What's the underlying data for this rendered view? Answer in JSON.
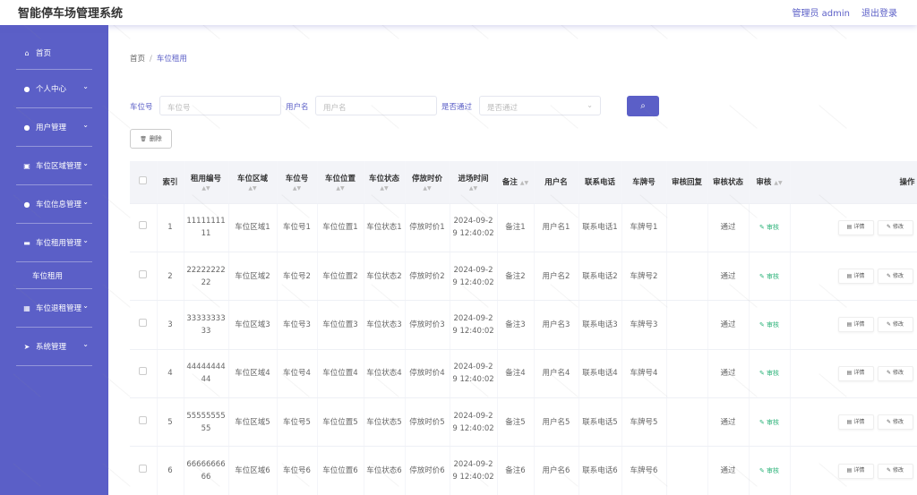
{
  "header": {
    "title": "智能停车场管理系统",
    "admin": "管理员 admin",
    "logout": "退出登录"
  },
  "sidebar": {
    "items": [
      {
        "label": "首页",
        "icon": "home-icon",
        "glyph": "⌂",
        "chevron": false
      },
      {
        "label": "个人中心",
        "icon": "user-icon",
        "glyph": "●",
        "chevron": true
      },
      {
        "label": "用户管理",
        "icon": "user-icon",
        "glyph": "●",
        "chevron": true
      },
      {
        "label": "车位区域管理",
        "icon": "card-icon",
        "glyph": "▣",
        "chevron": true
      },
      {
        "label": "车位信息管理",
        "icon": "person-icon",
        "glyph": "●",
        "chevron": true
      },
      {
        "label": "车位租用管理",
        "icon": "monitor-icon",
        "glyph": "▬",
        "chevron": true
      },
      {
        "label": "车位退租管理",
        "icon": "grid-icon",
        "glyph": "▦",
        "chevron": true
      },
      {
        "label": "系统管理",
        "icon": "send-icon",
        "glyph": "➤",
        "chevron": true
      }
    ],
    "sub_item": "车位租用"
  },
  "breadcrumb": {
    "home": "首页",
    "sep": "/",
    "current": "车位租用"
  },
  "search": {
    "spot_label": "车位号",
    "spot_placeholder": "车位号",
    "user_label": "用户名",
    "user_placeholder": "用户名",
    "pass_label": "是否通过",
    "pass_placeholder": "是否通过",
    "button_glyph": "⌕"
  },
  "toolbar": {
    "delete_label": "删除",
    "delete_glyph": "🗑"
  },
  "table": {
    "headers": [
      "索引",
      "租用编号",
      "车位区域",
      "车位号",
      "车位位置",
      "车位状态",
      "停放时价",
      "进场时间",
      "备注",
      "用户名",
      "联系电话",
      "车牌号",
      "审核回复",
      "审核状态",
      "审核",
      "操作"
    ],
    "sort_glyph": "▲▼",
    "audit_label": "审核",
    "audit_glyph": "✎",
    "detail_label": "详情",
    "detail_glyph": "▤",
    "edit_label": "修改",
    "edit_glyph": "✎",
    "rows": [
      {
        "index": "1",
        "rent_no": "1111111111",
        "area": "车位区域1",
        "spot": "车位号1",
        "location": "车位位置1",
        "status": "车位状态1",
        "price": "停放时价1",
        "entry": "2024-09-29 12:40:02",
        "remark": "备注1",
        "user": "用户名1",
        "phone": "联系电话1",
        "plate": "车牌号1",
        "reply": "",
        "audit_status": "通过"
      },
      {
        "index": "2",
        "rent_no": "2222222222",
        "area": "车位区域2",
        "spot": "车位号2",
        "location": "车位位置2",
        "status": "车位状态2",
        "price": "停放时价2",
        "entry": "2024-09-29 12:40:02",
        "remark": "备注2",
        "user": "用户名2",
        "phone": "联系电话2",
        "plate": "车牌号2",
        "reply": "",
        "audit_status": "通过"
      },
      {
        "index": "3",
        "rent_no": "3333333333",
        "area": "车位区域3",
        "spot": "车位号3",
        "location": "车位位置3",
        "status": "车位状态3",
        "price": "停放时价3",
        "entry": "2024-09-29 12:40:02",
        "remark": "备注3",
        "user": "用户名3",
        "phone": "联系电话3",
        "plate": "车牌号3",
        "reply": "",
        "audit_status": "通过"
      },
      {
        "index": "4",
        "rent_no": "4444444444",
        "area": "车位区域4",
        "spot": "车位号4",
        "location": "车位位置4",
        "status": "车位状态4",
        "price": "停放时价4",
        "entry": "2024-09-29 12:40:02",
        "remark": "备注4",
        "user": "用户名4",
        "phone": "联系电话4",
        "plate": "车牌号4",
        "reply": "",
        "audit_status": "通过"
      },
      {
        "index": "5",
        "rent_no": "5555555555",
        "area": "车位区域5",
        "spot": "车位号5",
        "location": "车位位置5",
        "status": "车位状态5",
        "price": "停放时价5",
        "entry": "2024-09-29 12:40:02",
        "remark": "备注5",
        "user": "用户名5",
        "phone": "联系电话5",
        "plate": "车牌号5",
        "reply": "",
        "audit_status": "通过"
      },
      {
        "index": "6",
        "rent_no": "6666666666",
        "area": "车位区域6",
        "spot": "车位号6",
        "location": "车位位置6",
        "status": "车位状态6",
        "price": "停放时价6",
        "entry": "2024-09-29 12:40:02",
        "remark": "备注6",
        "user": "用户名6",
        "phone": "联系电话6",
        "plate": "车牌号6",
        "reply": "",
        "audit_status": "通过"
      }
    ]
  }
}
